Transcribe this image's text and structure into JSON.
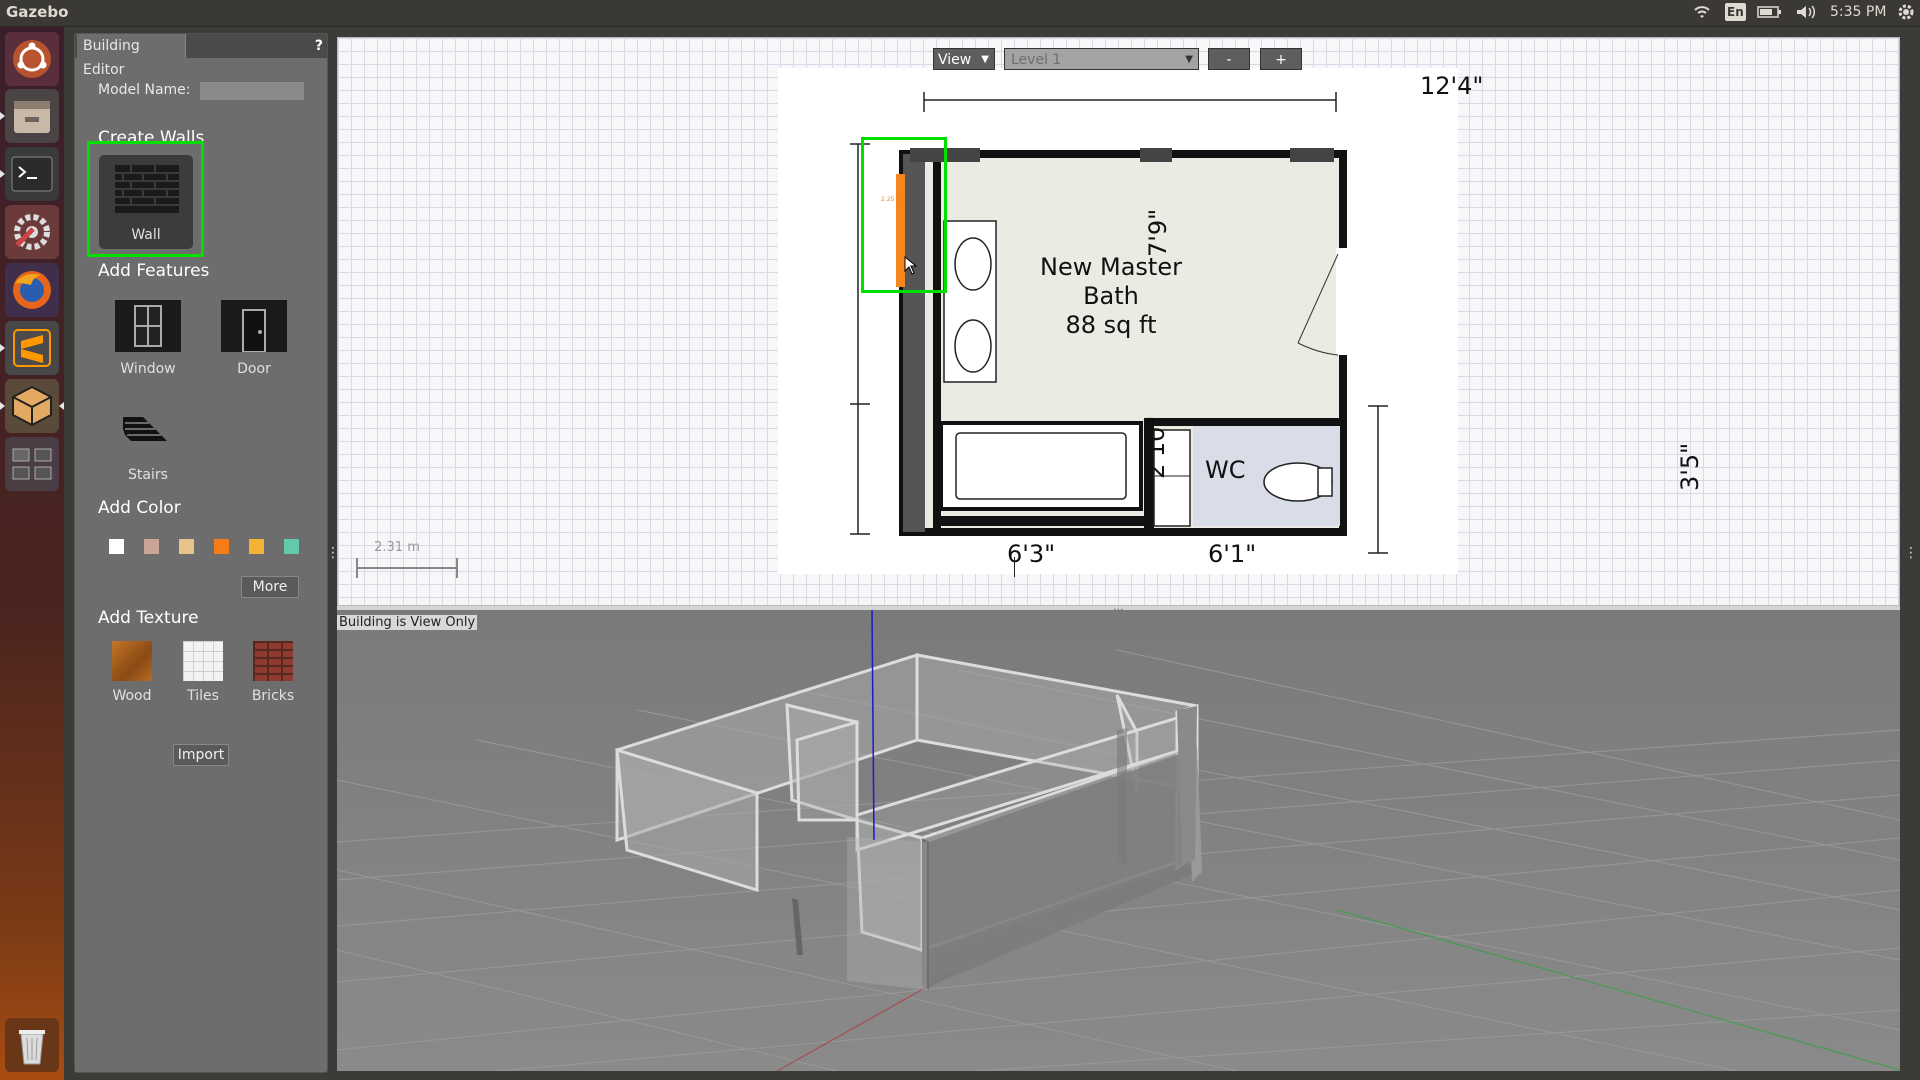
{
  "topbar": {
    "app_title": "Gazebo",
    "keyboard": "En",
    "clock": "5:35 PM"
  },
  "launcher": {
    "items": [
      "ubuntu-dash",
      "files",
      "terminal",
      "system-settings",
      "firefox",
      "sublime-text",
      "gazebo",
      "workspace-switcher",
      "trash"
    ]
  },
  "editor": {
    "tab_label": "Building Editor",
    "help": "?",
    "model_name_label": "Model Name:",
    "model_name_value": "",
    "create_walls": "Create Walls",
    "wall_label": "Wall",
    "add_features": "Add Features",
    "window_label": "Window",
    "door_label": "Door",
    "stairs_label": "Stairs",
    "add_color": "Add Color",
    "colors": [
      "#ffffff",
      "#c8a596",
      "#e8c28d",
      "#f57d18",
      "#f5b335",
      "#63c9ad"
    ],
    "more_label": "More",
    "add_texture": "Add Texture",
    "wood_label": "Wood",
    "tiles_label": "Tiles",
    "bricks_label": "Bricks",
    "import_label": "Import"
  },
  "plan": {
    "view_label": "View",
    "level_label": "Level 1",
    "minus_label": "-",
    "plus_label": "+",
    "scale_label": "2.31 m",
    "dim_top": "12'4\"",
    "dim_left_top": "7'9\"",
    "dim_left_bottom": "2'10\"",
    "dim_right": "3'5\"",
    "dim_bottom_left": "6'3\"",
    "dim_bottom_right": "6'1\"",
    "room_title_1": "New Master",
    "room_title_2": "Bath",
    "room_area": "88 sq ft",
    "wc_label": "WC",
    "wall_length_tag": "2.25 m"
  },
  "view3d": {
    "status": "Building is View Only"
  }
}
